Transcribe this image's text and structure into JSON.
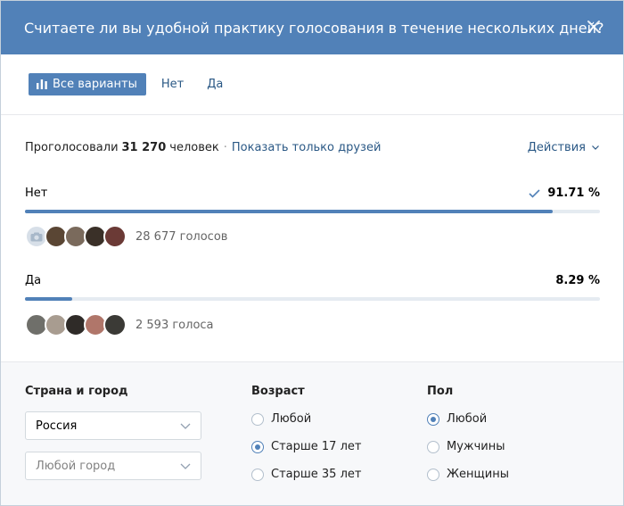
{
  "header": {
    "title": "Считаете ли вы удобной практику голосования в течение нескольких дней?"
  },
  "tabs": {
    "all_label": "Все варианты",
    "no_label": "Нет",
    "yes_label": "Да"
  },
  "summary": {
    "prefix": "Проголосовали",
    "count": "31 270",
    "suffix": "человек",
    "separator": "·",
    "friends_link": "Показать только друзей",
    "actions_label": "Действия"
  },
  "options": [
    {
      "label": "Нет",
      "percent_text": "91.71 %",
      "share": 0.9171,
      "voted_by_me": true,
      "votes_text": "28 677 голосов",
      "avatar_colors": [
        "#d7dfe8",
        "#5a4634",
        "#7a6a5c",
        "#3a3028",
        "#6b3a36"
      ]
    },
    {
      "label": "Да",
      "percent_text": "8.29 %",
      "share": 0.0829,
      "voted_by_me": false,
      "votes_text": "2 593 голоса",
      "avatar_colors": [
        "#6f6f6a",
        "#a89c90",
        "#2f2b28",
        "#b0766a",
        "#3b3a36"
      ]
    }
  ],
  "filters": {
    "location": {
      "title": "Страна и город",
      "country": "Россия",
      "city_placeholder": "Любой город"
    },
    "age": {
      "title": "Возраст",
      "options": [
        "Любой",
        "Старше 17 лет",
        "Старше 35 лет"
      ],
      "selected_index": 1
    },
    "sex": {
      "title": "Пол",
      "options": [
        "Любой",
        "Мужчины",
        "Женщины"
      ],
      "selected_index": 0
    }
  },
  "colors": {
    "accent": "#5181b8",
    "link": "#2a5885",
    "track": "#e5ebf1"
  },
  "icons": {
    "close": "close-icon",
    "bars": "bar-chart-icon",
    "check": "check-icon",
    "chevron": "chevron-down-icon",
    "camera": "camera-icon"
  }
}
